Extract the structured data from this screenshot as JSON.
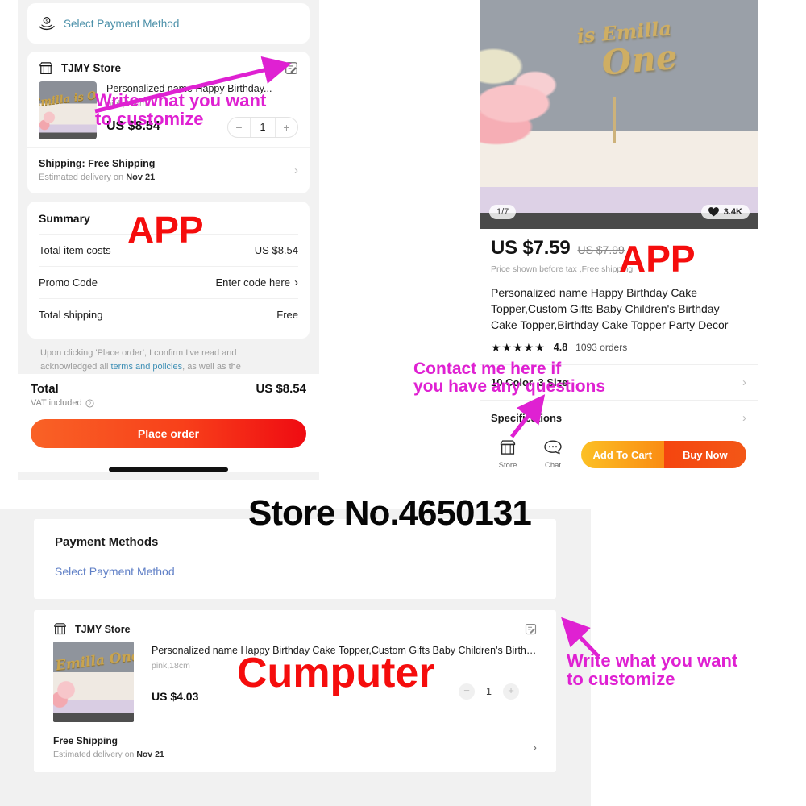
{
  "app_checkout": {
    "payment": {
      "label": "Select Payment Method",
      "icon": "coin-hand-icon"
    },
    "store": {
      "name": "TJMY Store",
      "edit_icon": "edit-note-icon"
    },
    "item": {
      "title": "Personalized name Happy Birthday...",
      "variant": "pink,18cm",
      "price": "US $8.54",
      "qty": "1",
      "minus": "−",
      "plus": "+",
      "thumb_text": "Emilla is One"
    },
    "shipping": {
      "label": "Shipping: Free Shipping",
      "eta_prefix": "Estimated delivery on ",
      "eta_date": "Nov 21",
      "chevron": "›"
    },
    "summary": {
      "title": "Summary",
      "rows": [
        {
          "label": "Total item costs",
          "value": "US $8.54"
        },
        {
          "label": "Promo Code",
          "value": "Enter code here",
          "chevron": "›"
        },
        {
          "label": "Total shipping",
          "value": "Free"
        }
      ]
    },
    "terms": {
      "line1": "Upon clicking 'Place order', I confirm I've read and",
      "line2_pre": "acknowledged all ",
      "link": "terms and policies",
      "line2_post": ", as well as the"
    },
    "total": {
      "label": "Total",
      "value": "US $8.54",
      "vat": "VAT included",
      "help_icon": "question-circle-icon"
    },
    "place_order": "Place order"
  },
  "app_product": {
    "hero": {
      "topper_line1": "is Emilla",
      "topper_line2": "One",
      "index_badge": "1/7",
      "fav_count": "3.4K",
      "fav_icon": "heart-icon"
    },
    "price_now": "US $7.59",
    "price_old": "US $7.99",
    "price_note": "Price shown before tax ,Free shipping",
    "title": "Personalized name Happy Birthday Cake Topper,Custom Gifts Baby Children's Birthday Cake Topper,Birthday Cake Topper Party Decor",
    "stars": "★★★★★",
    "rating": "4.8",
    "orders": "1093 orders",
    "options": [
      {
        "label": "10 Color, 3 Size",
        "chevron": "›"
      },
      {
        "label": "Specifications",
        "chevron": "›"
      }
    ],
    "actions": {
      "store": {
        "label": "Store",
        "icon": "store-icon"
      },
      "chat": {
        "label": "Chat",
        "icon": "chat-bubble-icon"
      },
      "add_to_cart": "Add To Cart",
      "buy_now": "Buy Now"
    }
  },
  "computer_panel": {
    "payment_methods_title": "Payment Methods",
    "select_payment_method": "Select Payment Method",
    "store": {
      "name": "TJMY Store",
      "icon": "store-icon",
      "edit_icon": "edit-note-icon"
    },
    "item": {
      "title": "Personalized name Happy Birthday Cake Topper,Custom Gifts Baby Children's Birthday Ca...",
      "variant": "pink,18cm",
      "price": "US $4.03",
      "qty": "1",
      "minus": "−",
      "plus": "+",
      "thumb_text": "Emilla One"
    },
    "shipping": {
      "label": "Free Shipping",
      "eta_prefix": "Estimated delivery on ",
      "eta_date": "Nov 21",
      "chevron": "›"
    }
  },
  "annotations": {
    "app_label_left": "APP",
    "app_label_right": "APP",
    "store_no": "Store No.4650131",
    "computer_label": "Cumputer",
    "customize_top_line1": "Write what you want",
    "customize_top_line2": "to customize",
    "customize_bottom_line1": "Write what you want",
    "customize_bottom_line2": "to customize",
    "contact_line1": "Contact me here if",
    "contact_line2": "you have any questions"
  },
  "colors": {
    "red_anno": "#f50d0d",
    "magenta_anno": "#df21d2",
    "place_order_gradient_start": "#f96226",
    "place_order_gradient_end": "#ef0b12",
    "add_to_cart": "#fa8c13",
    "buy_now": "#f5450f",
    "link_blue": "#4a8fa8",
    "computer_link_blue": "#5f7fc6"
  }
}
